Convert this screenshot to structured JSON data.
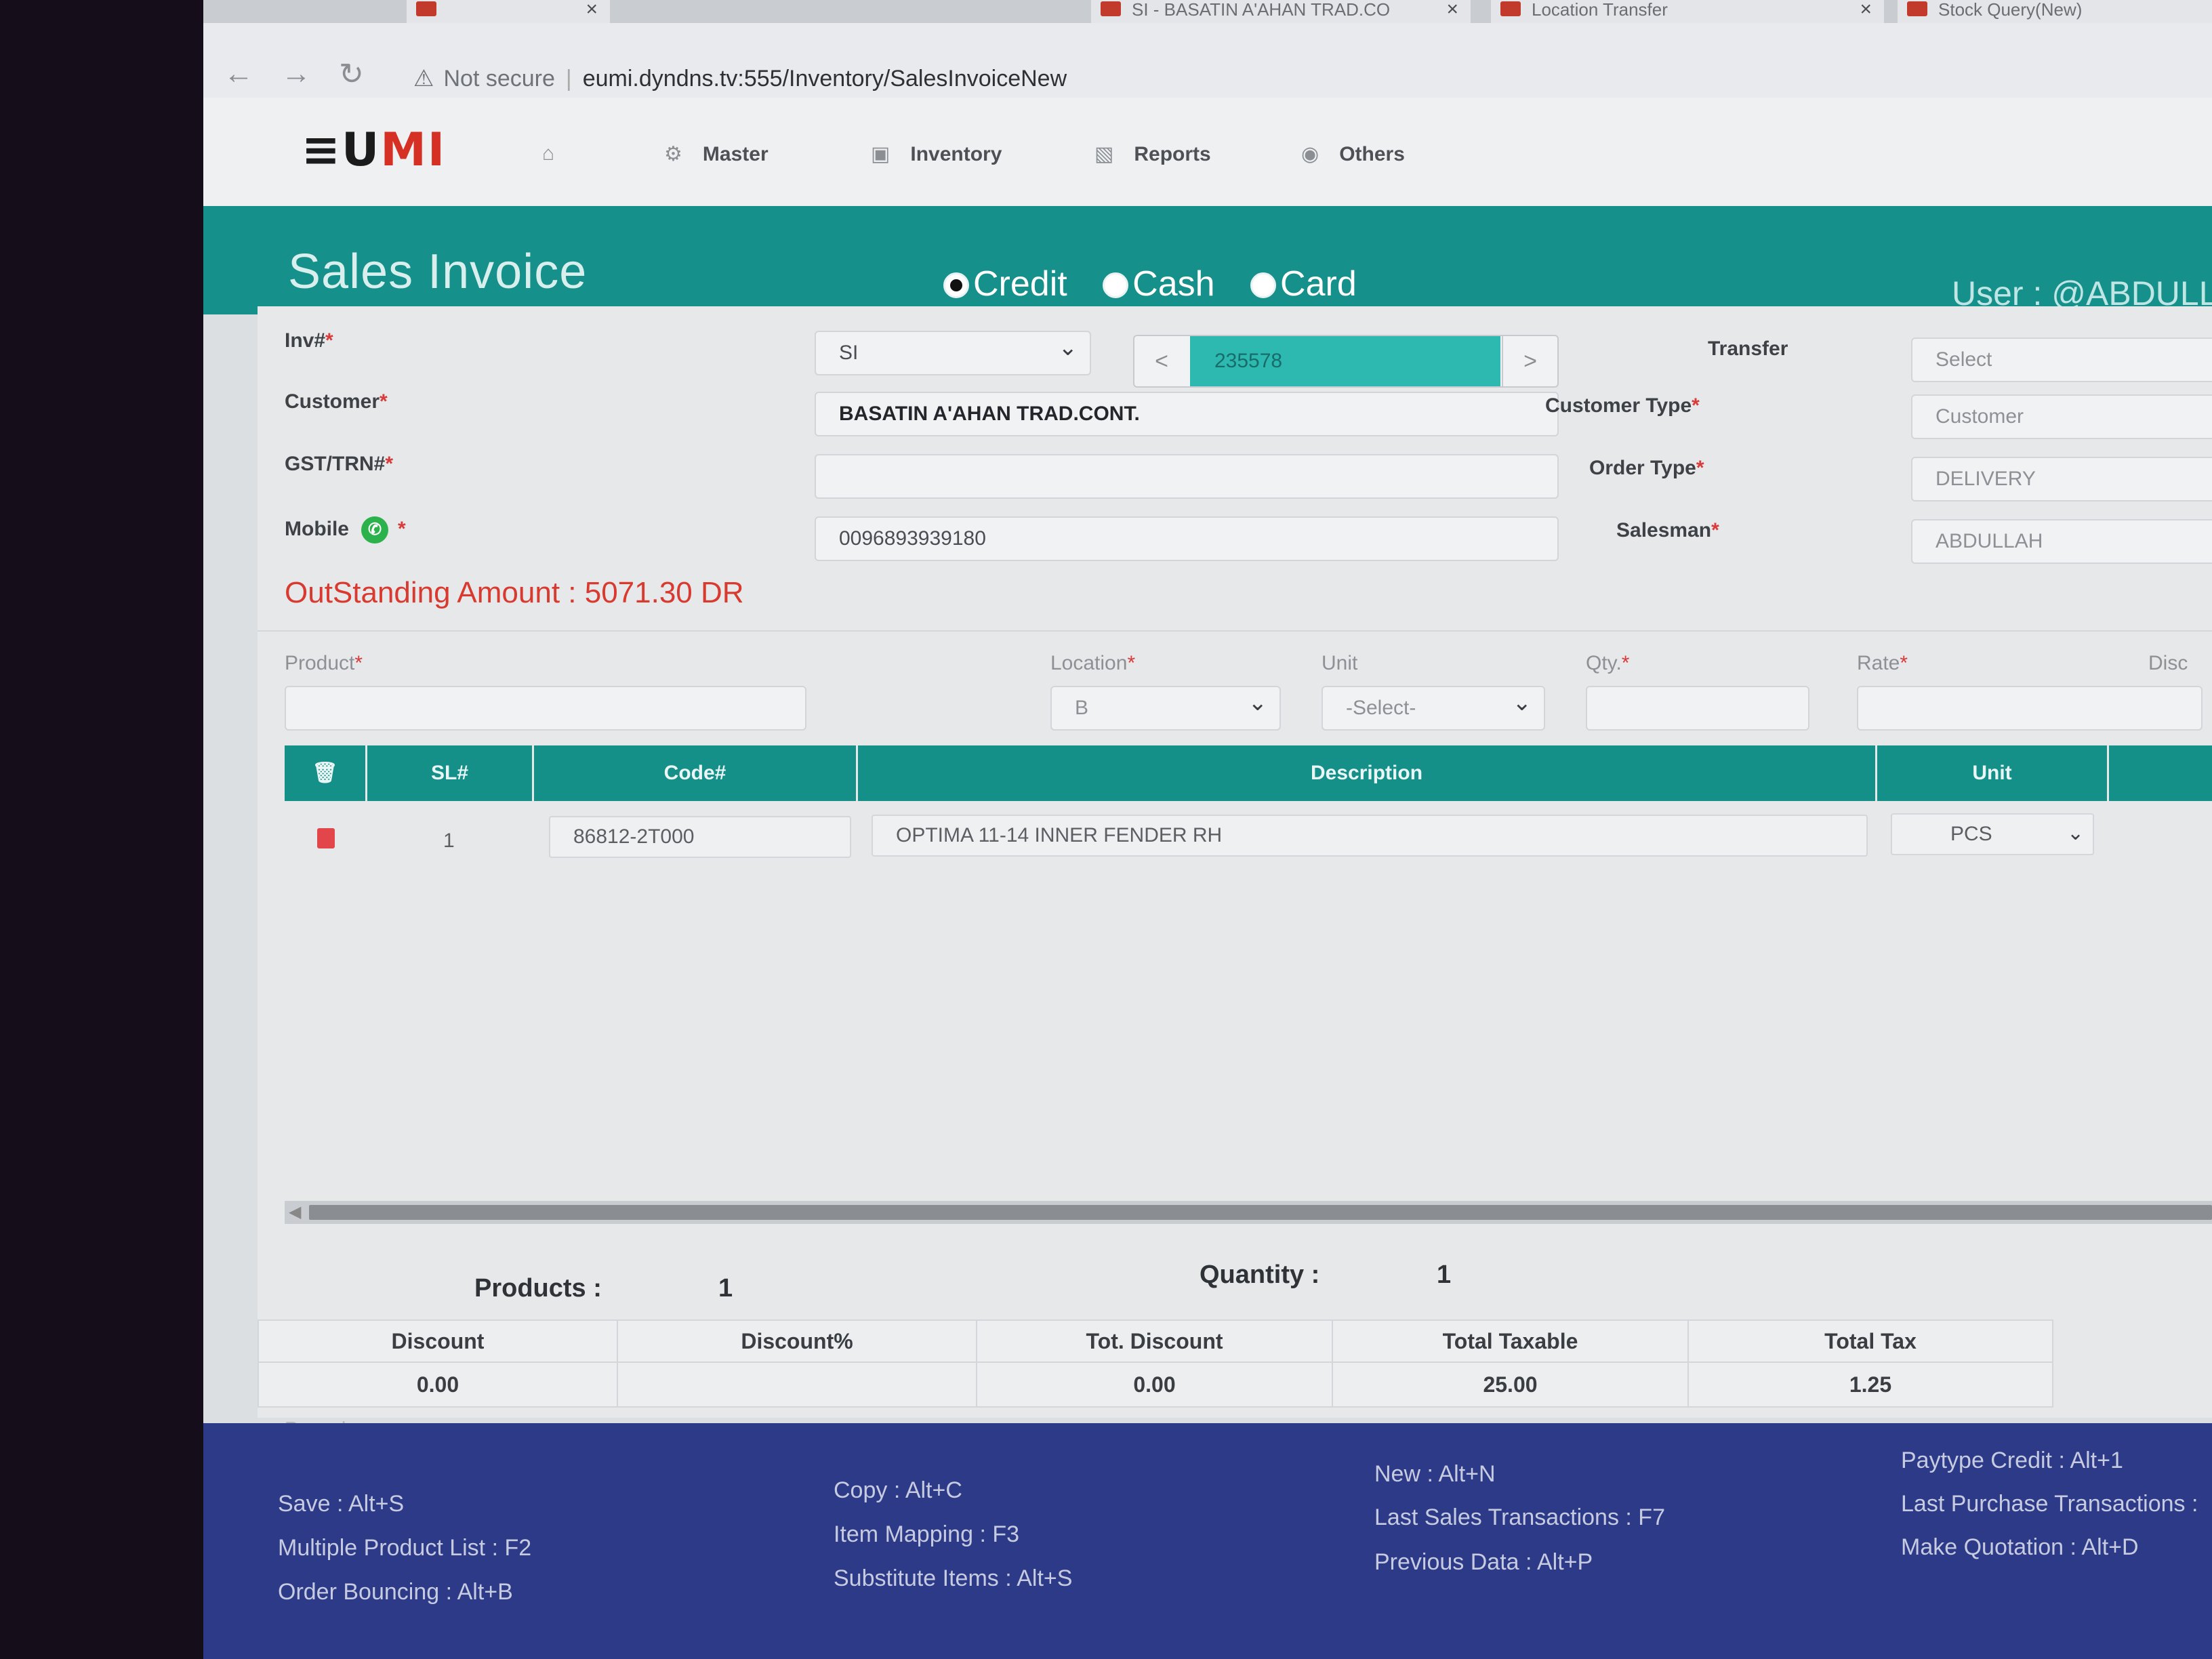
{
  "browser": {
    "tabs": [
      {
        "label": "",
        "close": "×"
      },
      {
        "label": "SI - BASATIN A'AHAN TRAD.CO",
        "close": "×"
      },
      {
        "label": "Location Transfer",
        "close": "×"
      },
      {
        "label": "Stock Query(New)",
        "close": ""
      }
    ],
    "security_label": "Not secure",
    "url_host": "eumi.dyndns.tv:555",
    "url_path": "/Inventory/SalesInvoiceNew"
  },
  "app": {
    "logo_dark": "≡U",
    "logo_red": "MI",
    "menu": [
      {
        "label": "",
        "icon": "home-icon"
      },
      {
        "label": "Master",
        "icon": "master-icon"
      },
      {
        "label": "Inventory",
        "icon": "inventory-icon"
      },
      {
        "label": "Reports",
        "icon": "reports-icon"
      },
      {
        "label": "Others",
        "icon": "others-icon"
      }
    ]
  },
  "page": {
    "title": "Sales Invoice",
    "pay_types": [
      {
        "label": "Credit",
        "selected": true
      },
      {
        "label": "Cash",
        "selected": false
      },
      {
        "label": "Card",
        "selected": false
      }
    ],
    "user": "User : @ABDULL"
  },
  "form": {
    "inv_label": "Inv#",
    "inv_prefix": "SI",
    "inv_number": "235578",
    "nav_prev": "<",
    "nav_next": ">",
    "customer_label": "Customer",
    "customer_value": "BASATIN A'AHAN TRAD.CONT.",
    "gst_label": "GST/TRN#",
    "gst_value": "",
    "mobile_label": "Mobile",
    "mobile_value": "0096893939180",
    "outstanding": "OutStanding Amount : 5071.30 DR",
    "transfer_label": "Transfer",
    "transfer_value": "Select",
    "customer_type_label": "Customer Type",
    "customer_type_value": "Customer",
    "order_type_label": "Order Type",
    "order_type_value": "DELIVERY",
    "salesman_label": "Salesman",
    "salesman_value": "ABDULLAH",
    "required_mark": "*"
  },
  "entry": {
    "product_label": "Product",
    "location_label": "Location",
    "location_value": "B",
    "unit_label": "Unit",
    "unit_value": "-Select-",
    "qty_label": "Qty.",
    "rate_label": "Rate",
    "disc_label": "Disc"
  },
  "grid": {
    "headers": {
      "sl": "SL#",
      "code": "Code#",
      "description": "Description",
      "unit": "Unit"
    },
    "rows": [
      {
        "sl": "1",
        "code": "86812-2T000",
        "description": "OPTIMA 11-14 INNER FENDER RH",
        "unit": "PCS"
      }
    ]
  },
  "totals": {
    "products_label": "Products :",
    "products_value": "1",
    "quantity_label": "Quantity :",
    "quantity_value": "1",
    "columns": [
      {
        "label": "Discount",
        "value": "0.00"
      },
      {
        "label": "Discount%",
        "value": ""
      },
      {
        "label": "Tot. Discount",
        "value": "0.00"
      },
      {
        "label": "Total Taxable",
        "value": "25.00"
      },
      {
        "label": "Total Tax",
        "value": "1.25"
      }
    ],
    "remarks_placeholder": "Remarks"
  },
  "shortcuts": [
    "Save : Alt+S",
    "Multiple Product List : F2",
    "Order Bouncing : Alt+B",
    "Copy : Alt+C",
    "Item Mapping : F3",
    "Substitute Items : Alt+S",
    "New : Alt+N",
    "Last Sales Transactions : F7",
    "Previous Data : Alt+P",
    "Paytype Credit : Alt+1",
    "Last Purchase Transactions :",
    "Make Quotation : Alt+D"
  ],
  "colors": {
    "teal": "#16908a",
    "accent_red": "#d93a2f",
    "footer": "#2d3a88"
  }
}
